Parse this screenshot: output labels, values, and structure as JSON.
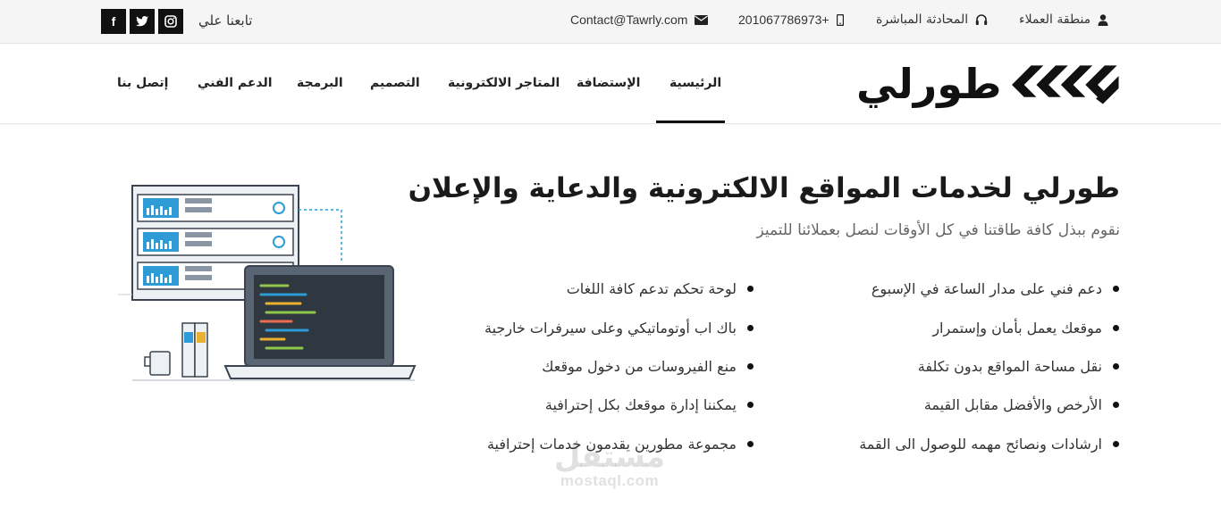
{
  "topbar": {
    "follow_label": "تابعنا علي",
    "social": [
      {
        "icon": "facebook-icon",
        "glyph": "f"
      },
      {
        "icon": "twitter-icon",
        "glyph": "t"
      },
      {
        "icon": "instagram-icon",
        "glyph": "◎"
      }
    ],
    "email": "Contact@Tawrly.com",
    "phone": "201067786973+",
    "live_chat": "المحادثة المباشرة",
    "clients_area": "منطقة العملاء"
  },
  "nav": {
    "brand": "طورلي",
    "items": [
      {
        "label": "الرئيسية",
        "active": true
      },
      {
        "label": "الإستضافة"
      },
      {
        "label": "المتاجر الالكترونية"
      },
      {
        "label": "التصميم"
      },
      {
        "label": "البرمجة"
      },
      {
        "label": "الدعم الفني"
      },
      {
        "label": "إتصل بنا"
      }
    ]
  },
  "hero": {
    "title": "طورلي لخدمات المواقع الالكترونية والدعاية والإعلان",
    "subtitle": "نقوم ببذل كافة طاقتنا في كل الأوقات لنصل بعملائنا للتميز",
    "features_right": [
      "دعم فني على مدار الساعة في الإسبوع",
      "موقعك يعمل بأمان وإستمرار",
      "نقل مساحة المواقع بدون تكلفة",
      "الأرخص والأفضل مقابل القيمة",
      "ارشادات ونصائح مهمه للوصول الى القمة"
    ],
    "features_left": [
      "لوحة تحكم تدعم كافة اللغات",
      "باك اب أوتوماتيكي وعلى سيرفرات خارجية",
      "منع الفيروسات من دخول موقعك",
      "يمكننا إدارة موقعك بكل إحترافية",
      "مجموعة مطورين يقدمون خدمات إحترافية"
    ]
  },
  "watermark": {
    "arabic": "مستقل",
    "latin": "mostaql.com"
  },
  "colors": {
    "accent": "#111111",
    "topbar_bg": "#f5f5f5",
    "illustration_blue": "#2e9bd6"
  }
}
